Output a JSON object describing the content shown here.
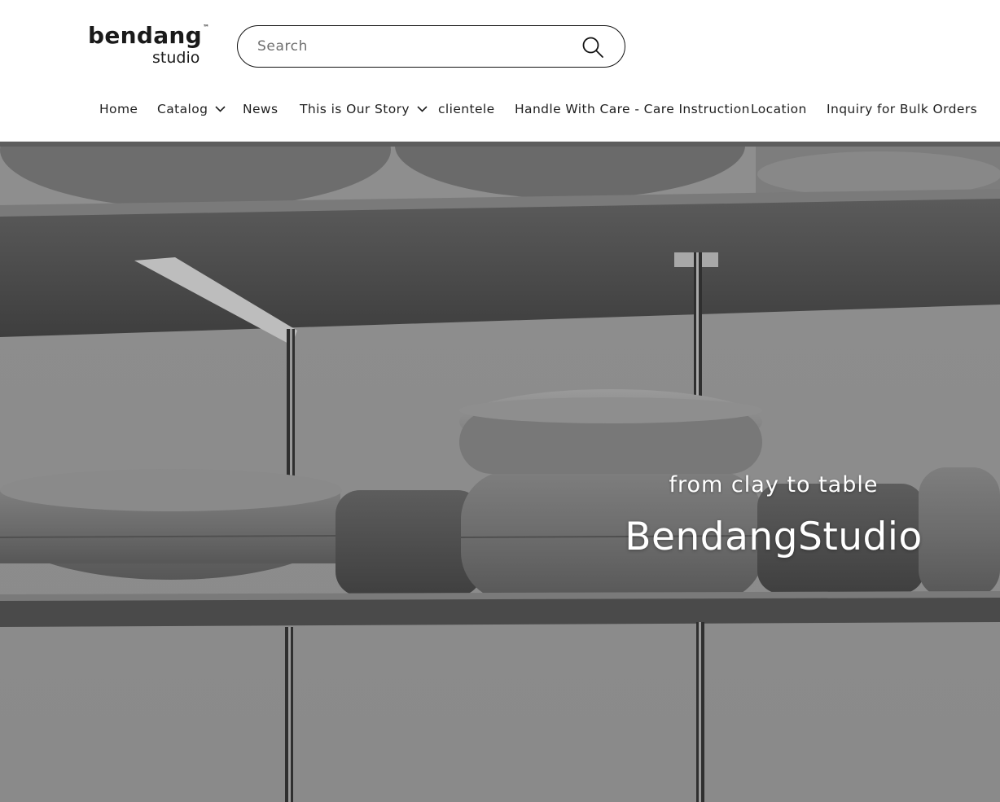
{
  "brand": {
    "logo_text": "bendang",
    "logo_tm": "™",
    "logo_sub": "studio"
  },
  "search": {
    "placeholder": "Search",
    "value": "",
    "icon": "search-icon"
  },
  "nav": {
    "items": [
      {
        "label": "Home",
        "has_dropdown": false
      },
      {
        "label": "Catalog",
        "has_dropdown": true
      },
      {
        "label": "News",
        "has_dropdown": false
      },
      {
        "label": "This is Our Story",
        "has_dropdown": true
      },
      {
        "label": "clientele",
        "has_dropdown": false
      },
      {
        "label": "Handle With Care - Care Instruction",
        "has_dropdown": false
      },
      {
        "label": "Location",
        "has_dropdown": false
      },
      {
        "label": "Inquiry for Bulk Orders",
        "has_dropdown": false
      }
    ]
  },
  "hero": {
    "subtitle": "from clay to table",
    "title": "BendangStudio"
  }
}
